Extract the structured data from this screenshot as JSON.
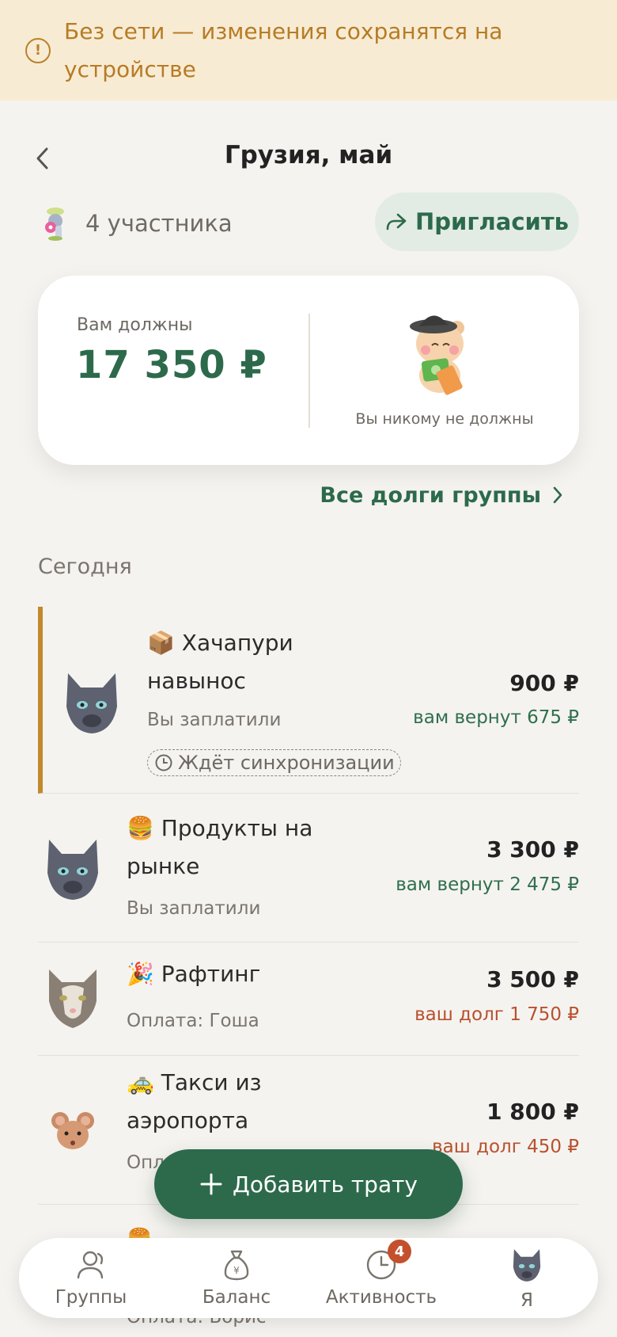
{
  "offline_banner": {
    "text": "Без сети — изменения сохранятся на устройстве",
    "icon": "exclamation-circle-icon"
  },
  "header": {
    "title": "Грузия, май",
    "back_icon": "chevron-left-icon"
  },
  "members": {
    "text": "4 участника",
    "icon": "group-mascot-icon"
  },
  "invite": {
    "label": "Пригласить",
    "icon": "share-arrow-icon"
  },
  "summary": {
    "owed_label": "Вам должны",
    "owed_amount": "17 350 ₽",
    "no_debt_text": "Вы никому не должны"
  },
  "all_debts": {
    "label": "Все долги группы"
  },
  "section": {
    "today": "Сегодня"
  },
  "expenses": [
    {
      "emoji": "📦",
      "title_line1": "Хачапури",
      "title_line2": "навынос",
      "sub": "Вы заплатили",
      "amount": "900 ₽",
      "share": "вам вернут 675 ₽",
      "sync": "Ждёт синхронизации",
      "avatar": "gray-cat-avatar"
    },
    {
      "emoji": "🍔",
      "title_line1": "Продукты на",
      "title_line2": "рынке",
      "sub": "Вы заплатили",
      "amount": "3 300 ₽",
      "share": "вам вернут 2 475 ₽",
      "avatar": "gray-cat-avatar"
    },
    {
      "emoji": "🎉",
      "title_line1": "Рафтинг",
      "sub": "Оплата: Гоша",
      "amount": "3 500 ₽",
      "share": "ваш долг 1 750 ₽",
      "avatar": "tabby-cat-avatar"
    },
    {
      "emoji": "🚕",
      "title_line1": "Такси из",
      "title_line2": "аэропорта",
      "sub": "Опла",
      "amount": "1 800 ₽",
      "share": "ваш долг 450 ₽",
      "avatar": "mouse-avatar"
    },
    {
      "emoji": "🍔",
      "sub": "Оплата: Борис"
    }
  ],
  "add_button": {
    "label": "Добавить трату",
    "icon": "plus-icon"
  },
  "tabbar": {
    "groups": "Группы",
    "balance": "Баланс",
    "activity": "Активность",
    "activity_badge": "4",
    "me": "Я"
  },
  "colors": {
    "accent": "#2c6a4b",
    "banner_bg": "#f8ebd4",
    "banner_text": "#b67c24",
    "debt": "#b7512f",
    "pending_bar": "#c08a2a"
  }
}
